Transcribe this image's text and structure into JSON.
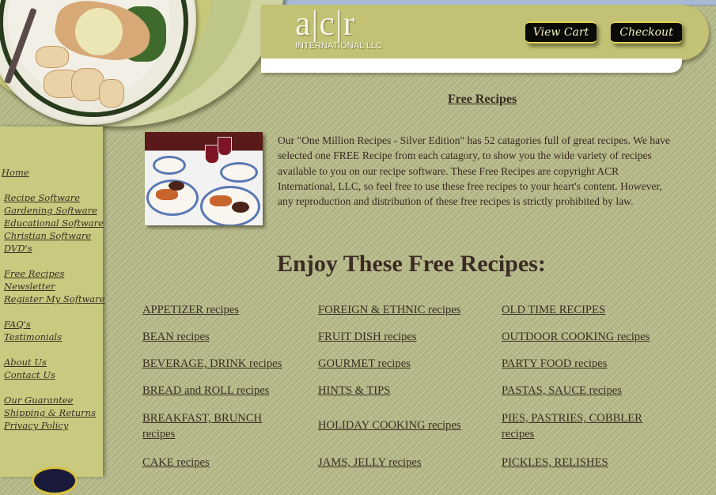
{
  "header": {
    "logo_letters": "a|c|r",
    "logo_subtitle": "INTERNATIONAL LLC",
    "view_cart_label": "View Cart",
    "checkout_label": "Checkout"
  },
  "sidebar": {
    "groups": [
      [
        "Home"
      ],
      [
        "Recipe Software",
        "Gardening Software",
        "Educational Software",
        "Christian Software",
        "DVD's"
      ],
      [
        "Free Recipes",
        "Newsletter",
        "Register My Software"
      ],
      [
        "FAQ's",
        "Testimonials"
      ],
      [
        "About Us",
        "Contact Us"
      ],
      [
        "Our Guarantee",
        "Shipping & Returns",
        "Privacy Policy"
      ]
    ]
  },
  "main": {
    "page_title": "Free Recipes",
    "intro": "Our \"One Million Recipes - Silver Edition\" has 52 catagories full of great recipes. We have selected one FREE Recipe from each catagory, to show you the wide variety of recipes available to you on our recipe software. These Free Recipes are copyright ACR International, LLC, so feel free to use these free recipes to your heart's content. However, any reproduction and distribution of these free recipes is strictly prohibited by law.",
    "heading": "Enjoy These Free Recipes:",
    "recipe_columns": [
      [
        "APPETIZER recipes",
        "BEAN recipes",
        "BEVERAGE, DRINK recipes",
        "BREAD and ROLL recipes",
        "BREAKFAST, BRUNCH recipes",
        "CAKE recipes"
      ],
      [
        "FOREIGN & ETHNIC recipes",
        "FRUIT DISH recipes",
        "GOURMET recipes",
        "HINTS & TIPS",
        "HOLIDAY COOKING recipes",
        "JAMS, JELLY recipes"
      ],
      [
        "OLD TIME RECIPES",
        "OUTDOOR COOKING recipes",
        "PARTY FOOD recipes",
        "PASTAS, SAUCE recipes",
        "PIES, PASTRIES, COBBLER recipes",
        "PICKLES, RELISHES"
      ]
    ]
  }
}
